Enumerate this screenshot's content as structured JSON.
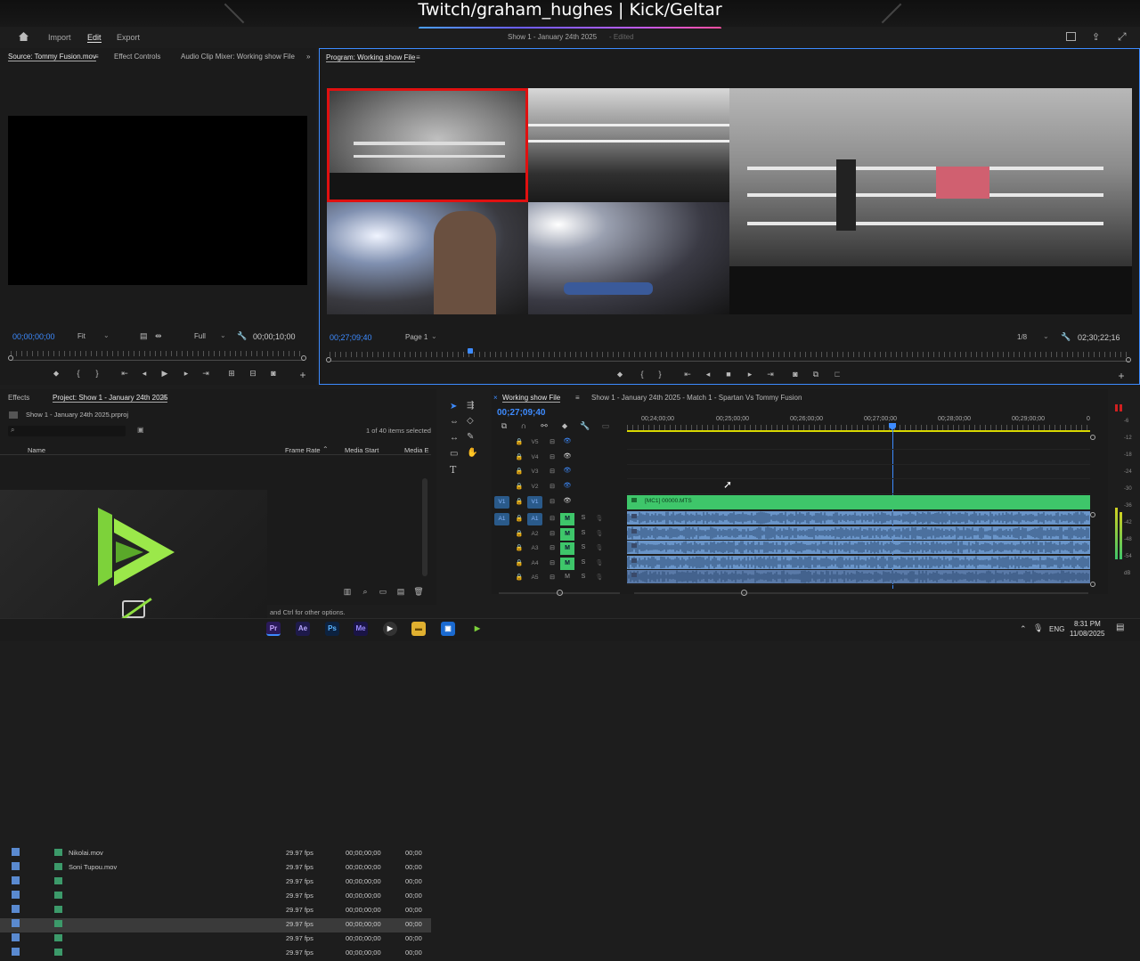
{
  "stream": {
    "title": "Twitch/graham_hughes | Kick/Geltar"
  },
  "menu": {
    "import": "Import",
    "edit": "Edit",
    "export": "Export",
    "doc_title": "Show 1 - January 24th 2025",
    "doc_state": "- Edited"
  },
  "source_panel": {
    "tabs": [
      "Source: Tommy Fusion.mov",
      "Effect Controls",
      "Audio Clip Mixer: Working show File"
    ],
    "timecode": "00;00;00;00",
    "fit": "Fit",
    "quality": "Full",
    "duration": "00;00;10;00"
  },
  "program_panel": {
    "tab": "Program: Working show File",
    "timecode": "00;27;09;40",
    "page": "Page 1",
    "ratio": "1/8",
    "duration": "02;30;22;16"
  },
  "project_panel": {
    "tabs": [
      "Effects",
      "Project: Show 1 - January 24th 2025"
    ],
    "file": "Show 1 - January 24th 2025.prproj",
    "selection": "1 of 40 items selected",
    "columns": [
      "Name",
      "Frame Rate",
      "Media Start",
      "Media E"
    ],
    "rows": [
      {
        "name": "Nikolai.mov",
        "fps": "29.97 fps",
        "start": "00;00;00;00",
        "end": "00;00"
      },
      {
        "name": "Soni Tupou.mov",
        "fps": "29.97 fps",
        "start": "00;00;00;00",
        "end": "00;00"
      },
      {
        "name": "",
        "fps": "29.97 fps",
        "start": "00;00;00;00",
        "end": "00;00"
      },
      {
        "name": "",
        "fps": "29.97 fps",
        "start": "00;00;00;00",
        "end": "00;00"
      },
      {
        "name": "",
        "fps": "29.97 fps",
        "start": "00;00;00;00",
        "end": "00;00"
      },
      {
        "name": "",
        "fps": "29.97 fps",
        "start": "00;00;00;00",
        "end": "00;00"
      },
      {
        "name": "",
        "fps": "29.97 fps",
        "start": "00;00;00;00",
        "end": "00;00"
      },
      {
        "name": "",
        "fps": "29.97 fps",
        "start": "00;00;00;00",
        "end": "00;00"
      }
    ],
    "tooltip_tail": "and Ctrl for other options."
  },
  "timeline": {
    "tabs": [
      "Working show File",
      "Show 1 - January 24th 2025 - Match 1 - Spartan Vs Tommy Fusion"
    ],
    "timecode": "00;27;09;40",
    "ruler": [
      "00;24;00;00",
      "00;25;00;00",
      "00;26;00;00",
      "00;27;00;00",
      "00;28;00;00",
      "00;29;00;00",
      "0"
    ],
    "video_tracks": [
      "V5",
      "V4",
      "V3",
      "V2",
      "V1"
    ],
    "audio_tracks": [
      "A1",
      "A2",
      "A3",
      "A4",
      "A5"
    ],
    "clip_label": "[MC1] 00000.MTS",
    "meter_labels": [
      "-6",
      "-12",
      "-18",
      "-24",
      "-30",
      "-36",
      "-42",
      "-48",
      "-54",
      "dB"
    ]
  },
  "taskbar": {
    "apps": [
      "Pr",
      "Ae",
      "Ps",
      "Me"
    ],
    "lang": "ENG",
    "time": "8:31 PM",
    "date": "11/08/2025"
  },
  "colors": {
    "accent_blue": "#3d8bff",
    "clip_green": "#3ec66a",
    "audio_blue": "#6a95c9",
    "selection_red": "#e01010",
    "playhead": "#3d8bff"
  }
}
